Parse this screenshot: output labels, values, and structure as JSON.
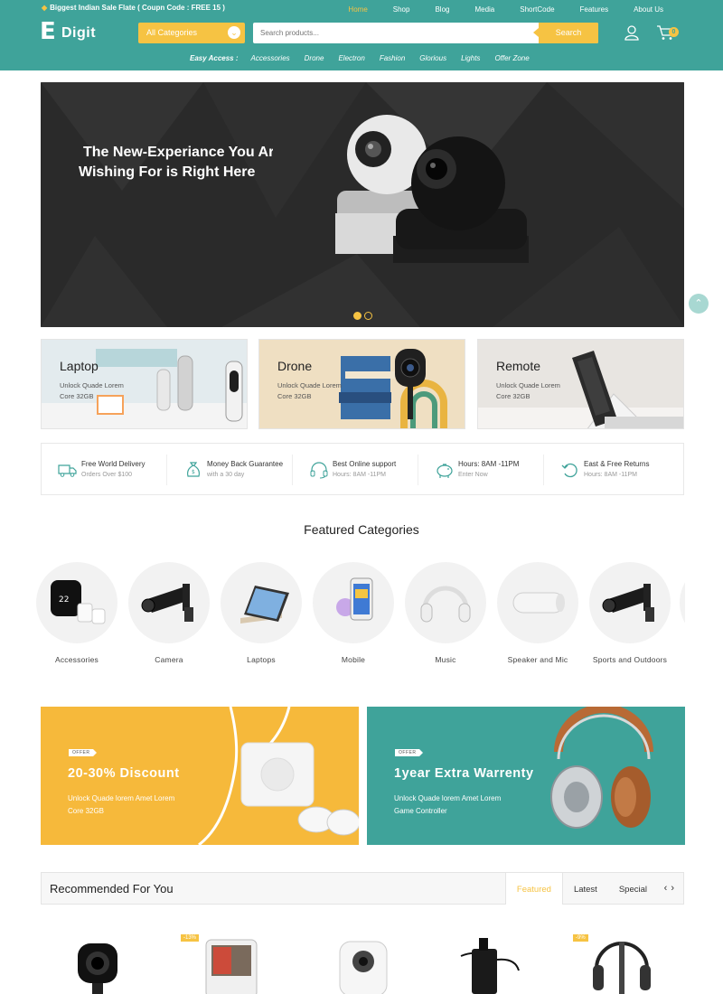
{
  "header": {
    "promo": "Biggest Indian Sale Flate ( Coupn Code : FREE 15 )",
    "nav": [
      "Home",
      "Shop",
      "Blog",
      "Media",
      "ShortCode",
      "Features",
      "About Us"
    ],
    "logo_e": "E",
    "logo_text": "Digit",
    "category_select": "All Categories",
    "search_placeholder": "Search products...",
    "search_button": "Search",
    "cart_count": "0",
    "easy_access_label": "Easy Access :",
    "easy_access": [
      "Accessories",
      "Drone",
      "Electron",
      "Fashion",
      "Glorious",
      "Lights",
      "Offer Zone"
    ],
    "accent": "#3fa39a",
    "highlight": "#f6c343"
  },
  "hero": {
    "line1": "The New-Experiance You Are",
    "line2": "Wishing For is Right Here"
  },
  "category_banners": [
    {
      "title": "Laptop",
      "desc1": "Unlock Quade Lorem",
      "desc2": "Core 32GB"
    },
    {
      "title": "Drone",
      "desc1": "Unlock Quade Lorem",
      "desc2": "Core 32GB"
    },
    {
      "title": "Remote",
      "desc1": "Unlock Quade Lorem",
      "desc2": "Core 32GB"
    }
  ],
  "services": [
    {
      "icon": "truck-icon",
      "title": "Free World Delivery",
      "sub": "Orders Over $100"
    },
    {
      "icon": "money-bag-icon",
      "title": "Money Back Guarantee",
      "sub": "with a 30 day"
    },
    {
      "icon": "headset-icon",
      "title": "Best Online support",
      "sub": "Hours: 8AM -11PM"
    },
    {
      "icon": "piggy-bank-icon",
      "title": "Hours: 8AM -11PM",
      "sub": "Enter Now"
    },
    {
      "icon": "return-icon",
      "title": "East & Free Returns",
      "sub": "Hours: 8AM -11PM"
    }
  ],
  "featured": {
    "title": "Featured Categories",
    "items": [
      "Accessories",
      "Camera",
      "Laptops",
      "Mobile",
      "Music",
      "Speaker and Mic",
      "Sports and Outdoors"
    ]
  },
  "offers": [
    {
      "badge": "OFFER",
      "title": "20-30% Discount",
      "desc1": "Unlock Quade lorem Amet Lorem",
      "desc2": "Core 32GB"
    },
    {
      "badge": "OFFER",
      "title": "1year Extra Warrenty",
      "desc1": "Unlock Quade lorem Amet Lorem",
      "desc2": "Game Controller"
    }
  ],
  "recommended": {
    "title": "Recommended For You",
    "tabs": [
      "Featured",
      "Latest",
      "Special"
    ],
    "sale_badges": [
      "-13%",
      "-9%"
    ]
  }
}
